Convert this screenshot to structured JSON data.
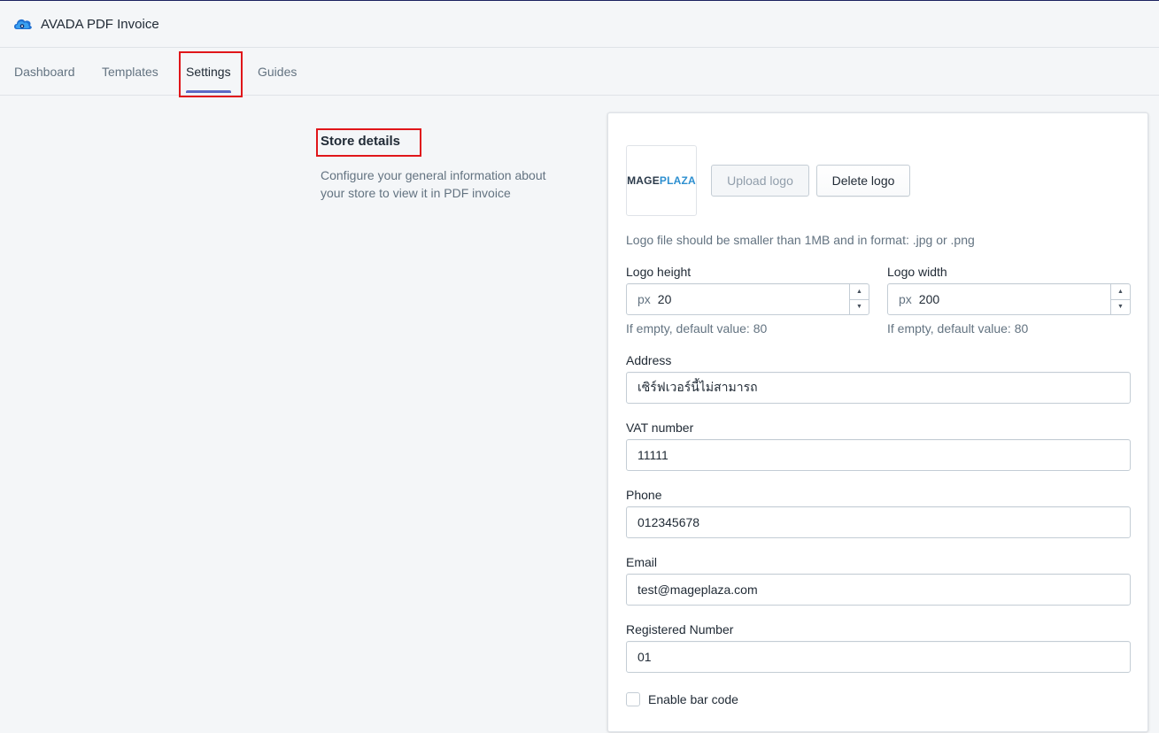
{
  "app": {
    "title": "AVADA PDF Invoice",
    "logo_icon": "avada-cloud-icon"
  },
  "nav": {
    "tabs": [
      {
        "label": "Dashboard",
        "active": false
      },
      {
        "label": "Templates",
        "active": false
      },
      {
        "label": "Settings",
        "active": true
      },
      {
        "label": "Guides",
        "active": false
      }
    ]
  },
  "section": {
    "title": "Store details",
    "description": "Configure your general information about your store to view it in PDF invoice"
  },
  "logo": {
    "brand_part1": "MAGE",
    "brand_part2": "PLAZA",
    "upload_label": "Upload logo",
    "delete_label": "Delete logo",
    "help": "Logo file should be smaller than 1MB and in format: .jpg or .png"
  },
  "logo_height": {
    "label": "Logo height",
    "prefix": "px",
    "value": "20",
    "help": "If empty, default value: 80"
  },
  "logo_width": {
    "label": "Logo width",
    "prefix": "px",
    "value": "200",
    "help": "If empty, default value: 80"
  },
  "address": {
    "label": "Address",
    "value": "เซิร์ฟเวอร์นี้ไม่สามารถ"
  },
  "vat": {
    "label": "VAT number",
    "value": "11111"
  },
  "phone": {
    "label": "Phone",
    "value": "012345678"
  },
  "email": {
    "label": "Email",
    "value": "test@mageplaza.com"
  },
  "registered": {
    "label": "Registered Number",
    "value": "01"
  },
  "barcode": {
    "label": "Enable bar code",
    "checked": false
  },
  "colors": {
    "accent": "#5c6ac4",
    "highlight": "#e0161a",
    "background": "#f4f6f8"
  }
}
